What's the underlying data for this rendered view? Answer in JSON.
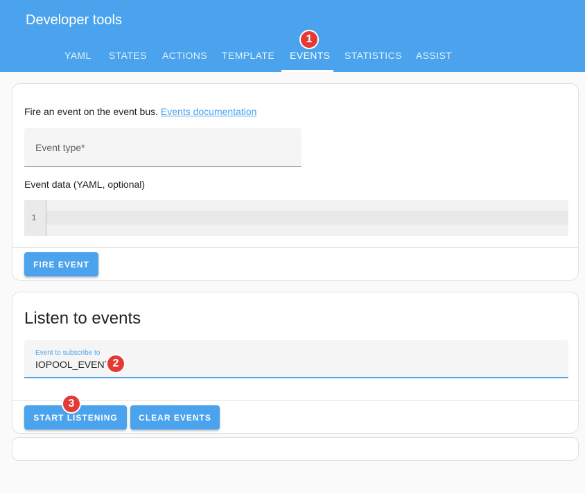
{
  "header": {
    "title": "Developer tools",
    "tabs": [
      {
        "label": "YAML"
      },
      {
        "label": "STATES"
      },
      {
        "label": "ACTIONS"
      },
      {
        "label": "TEMPLATE"
      },
      {
        "label": "EVENTS",
        "active": true
      },
      {
        "label": "STATISTICS"
      },
      {
        "label": "ASSIST"
      }
    ]
  },
  "annotations": {
    "one": "1",
    "two": "2",
    "three": "3"
  },
  "fire_card": {
    "intro_text": "Fire an event on the event bus. ",
    "docs_link": "Events documentation",
    "event_type_label": "Event type*",
    "event_data_label": "Event data (YAML, optional)",
    "editor_line": "1",
    "fire_button": "FIRE EVENT"
  },
  "listen_card": {
    "title": "Listen to events",
    "subscribe_label": "Event to subscribe to",
    "subscribe_value": "IOPOOL_EVENT",
    "start_button": "START LISTENING",
    "clear_button": "CLEAR EVENTS"
  },
  "colors": {
    "accent": "#4aa3ec",
    "badge": "#e53935"
  }
}
